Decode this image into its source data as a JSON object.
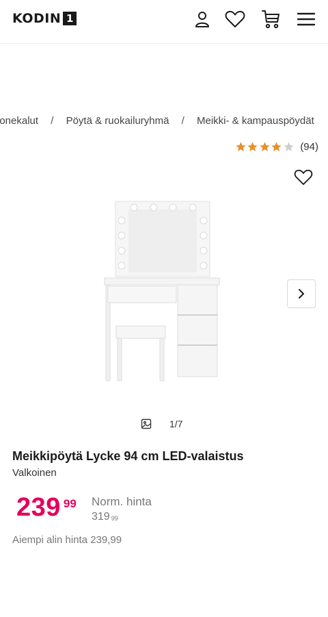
{
  "header": {
    "logo_text": "KODIN",
    "logo_number": "1",
    "icons": [
      "user-icon",
      "heart-icon",
      "cart-icon",
      "menu-icon"
    ]
  },
  "breadcrumb": {
    "items": [
      "uonekalut",
      "Pöytä & ruokailuryhmä",
      "Meikki- & kampauspöydät"
    ],
    "separator": "/"
  },
  "rating": {
    "stars": 4,
    "max": 5,
    "count": "(94)",
    "star_color": "#e8902a",
    "empty_star_color": "#cfcfcf"
  },
  "gallery": {
    "counter": "1/7"
  },
  "product": {
    "title": "Meikkipöytä Lycke 94 cm LED-valaistus",
    "variant": "Valkoinen",
    "price_int": "239",
    "price_dec": "99",
    "price_color": "#e5005b",
    "norm_label": "Norm. hinta",
    "norm_price_int": "319",
    "norm_price_dec": "99",
    "previous_lowest": "Aiempi alin hinta 239,99"
  }
}
